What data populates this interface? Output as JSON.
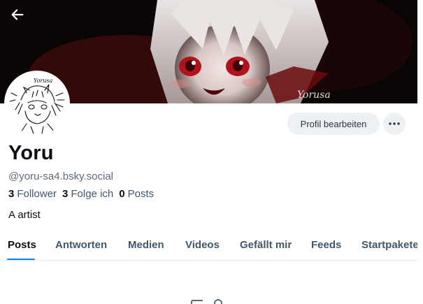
{
  "profile": {
    "name": "Yoru",
    "handle": "@yoru-sa4.bsky.social",
    "bio": "A artist",
    "stats": {
      "followers_count": "3",
      "followers_label": "Follower",
      "following_count": "3",
      "following_label": "Folge ich",
      "posts_count": "0",
      "posts_label": "Posts"
    },
    "banner_signature": "Yorusa",
    "avatar_signature": "Yorusa"
  },
  "actions": {
    "edit_profile": "Profil bearbeiten",
    "more_icon": "ellipsis-icon",
    "back_icon": "arrow-left-icon"
  },
  "tabs": [
    {
      "label": "Posts",
      "active": true
    },
    {
      "label": "Antworten",
      "active": false
    },
    {
      "label": "Medien",
      "active": false
    },
    {
      "label": "Videos",
      "active": false
    },
    {
      "label": "Gefällt mir",
      "active": false
    },
    {
      "label": "Feeds",
      "active": false
    },
    {
      "label": "Startpakete",
      "active": false
    }
  ],
  "colors": {
    "accent": "#1083fe",
    "button_bg": "#eef1f4",
    "muted_text": "#5b6b7c"
  }
}
